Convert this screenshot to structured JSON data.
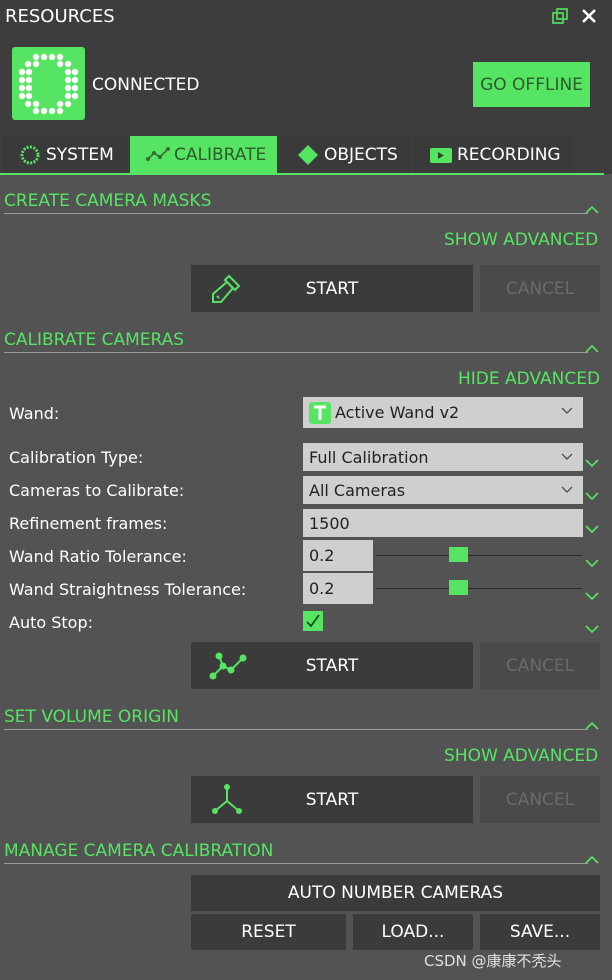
{
  "window": {
    "title": "RESOURCES",
    "icons": [
      "popout-icon",
      "close-icon"
    ]
  },
  "status": {
    "text": "CONNECTED",
    "go_offline": "GO OFFLINE",
    "accent": "#55e563"
  },
  "tabs": [
    {
      "label": "SYSTEM",
      "icon": "system-icon"
    },
    {
      "label": "CALIBRATE",
      "icon": "calibrate-icon",
      "active": true
    },
    {
      "label": "OBJECTS",
      "icon": "diamond-icon"
    },
    {
      "label": "RECORDING",
      "icon": "camera-icon"
    }
  ],
  "masks": {
    "title": "CREATE CAMERA MASKS",
    "advanced": "SHOW ADVANCED",
    "start": "START",
    "cancel": "CANCEL"
  },
  "calibrate": {
    "title": "CALIBRATE CAMERAS",
    "advanced": "HIDE ADVANCED",
    "wand_label": "Wand:",
    "wand_value": "Active Wand v2",
    "type_label": "Calibration Type:",
    "type_value": "Full Calibration",
    "cameras_label": "Cameras to Calibrate:",
    "cameras_value": "All Cameras",
    "refine_label": "Refinement frames:",
    "refine_value": "1500",
    "ratio_label": "Wand Ratio Tolerance:",
    "ratio_value": "0.2",
    "straight_label": "Wand Straightness Tolerance:",
    "straight_value": "0.2",
    "autostop_label": "Auto Stop:",
    "autostop_checked": true,
    "start": "START",
    "cancel": "CANCEL"
  },
  "origin": {
    "title": "SET VOLUME ORIGIN",
    "advanced": "SHOW ADVANCED",
    "start": "START",
    "cancel": "CANCEL"
  },
  "manage": {
    "title": "MANAGE CAMERA CALIBRATION",
    "auto_number": "AUTO NUMBER CAMERAS",
    "reset": "RESET",
    "load": "LOAD...",
    "save": "SAVE..."
  },
  "watermark": "CSDN @康康不秃头"
}
